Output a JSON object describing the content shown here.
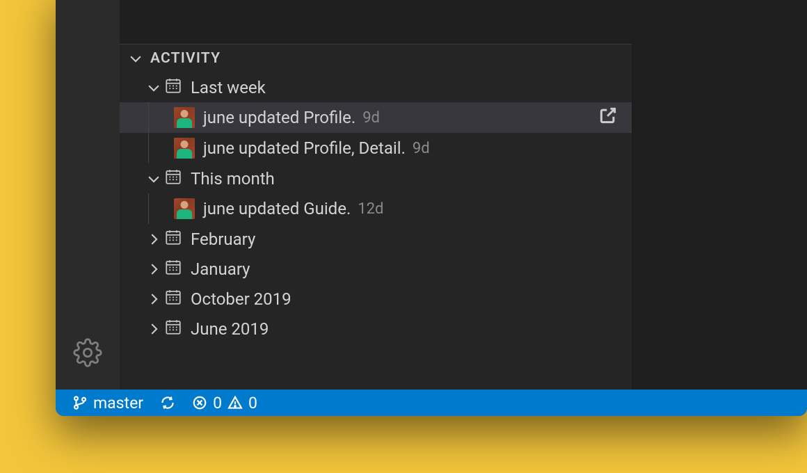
{
  "section": {
    "title": "Activity"
  },
  "groups": [
    {
      "label": "Last week",
      "expanded": true,
      "items": [
        {
          "user": "june",
          "text": "june updated Profile.",
          "ago": "9d",
          "selected": true,
          "showOpen": true
        },
        {
          "user": "june",
          "text": "june updated Profile, Detail.",
          "ago": "9d",
          "selected": false,
          "showOpen": false
        }
      ]
    },
    {
      "label": "This month",
      "expanded": true,
      "items": [
        {
          "user": "june",
          "text": "june updated Guide.",
          "ago": "12d",
          "selected": false,
          "showOpen": false
        }
      ]
    },
    {
      "label": "February",
      "expanded": false,
      "items": []
    },
    {
      "label": "January",
      "expanded": false,
      "items": []
    },
    {
      "label": "October 2019",
      "expanded": false,
      "items": []
    },
    {
      "label": "June 2019",
      "expanded": false,
      "items": []
    }
  ],
  "statusbar": {
    "branch": "master",
    "errors": "0",
    "warnings": "0"
  }
}
